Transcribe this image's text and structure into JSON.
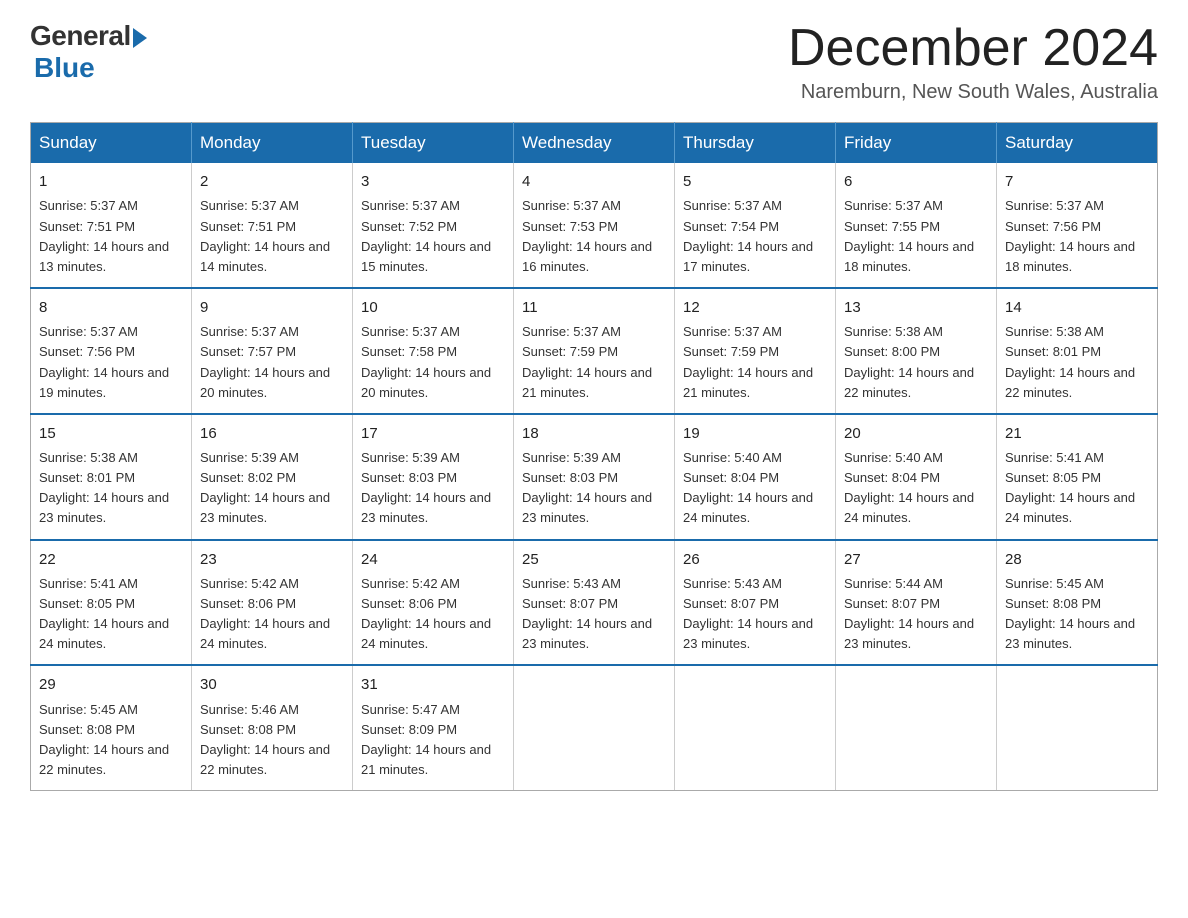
{
  "logo": {
    "general": "General",
    "blue": "Blue"
  },
  "title": "December 2024",
  "subtitle": "Naremburn, New South Wales, Australia",
  "weekdays": [
    "Sunday",
    "Monday",
    "Tuesday",
    "Wednesday",
    "Thursday",
    "Friday",
    "Saturday"
  ],
  "weeks": [
    [
      {
        "day": "1",
        "sunrise": "5:37 AM",
        "sunset": "7:51 PM",
        "daylight": "14 hours and 13 minutes."
      },
      {
        "day": "2",
        "sunrise": "5:37 AM",
        "sunset": "7:51 PM",
        "daylight": "14 hours and 14 minutes."
      },
      {
        "day": "3",
        "sunrise": "5:37 AM",
        "sunset": "7:52 PM",
        "daylight": "14 hours and 15 minutes."
      },
      {
        "day": "4",
        "sunrise": "5:37 AM",
        "sunset": "7:53 PM",
        "daylight": "14 hours and 16 minutes."
      },
      {
        "day": "5",
        "sunrise": "5:37 AM",
        "sunset": "7:54 PM",
        "daylight": "14 hours and 17 minutes."
      },
      {
        "day": "6",
        "sunrise": "5:37 AM",
        "sunset": "7:55 PM",
        "daylight": "14 hours and 18 minutes."
      },
      {
        "day": "7",
        "sunrise": "5:37 AM",
        "sunset": "7:56 PM",
        "daylight": "14 hours and 18 minutes."
      }
    ],
    [
      {
        "day": "8",
        "sunrise": "5:37 AM",
        "sunset": "7:56 PM",
        "daylight": "14 hours and 19 minutes."
      },
      {
        "day": "9",
        "sunrise": "5:37 AM",
        "sunset": "7:57 PM",
        "daylight": "14 hours and 20 minutes."
      },
      {
        "day": "10",
        "sunrise": "5:37 AM",
        "sunset": "7:58 PM",
        "daylight": "14 hours and 20 minutes."
      },
      {
        "day": "11",
        "sunrise": "5:37 AM",
        "sunset": "7:59 PM",
        "daylight": "14 hours and 21 minutes."
      },
      {
        "day": "12",
        "sunrise": "5:37 AM",
        "sunset": "7:59 PM",
        "daylight": "14 hours and 21 minutes."
      },
      {
        "day": "13",
        "sunrise": "5:38 AM",
        "sunset": "8:00 PM",
        "daylight": "14 hours and 22 minutes."
      },
      {
        "day": "14",
        "sunrise": "5:38 AM",
        "sunset": "8:01 PM",
        "daylight": "14 hours and 22 minutes."
      }
    ],
    [
      {
        "day": "15",
        "sunrise": "5:38 AM",
        "sunset": "8:01 PM",
        "daylight": "14 hours and 23 minutes."
      },
      {
        "day": "16",
        "sunrise": "5:39 AM",
        "sunset": "8:02 PM",
        "daylight": "14 hours and 23 minutes."
      },
      {
        "day": "17",
        "sunrise": "5:39 AM",
        "sunset": "8:03 PM",
        "daylight": "14 hours and 23 minutes."
      },
      {
        "day": "18",
        "sunrise": "5:39 AM",
        "sunset": "8:03 PM",
        "daylight": "14 hours and 23 minutes."
      },
      {
        "day": "19",
        "sunrise": "5:40 AM",
        "sunset": "8:04 PM",
        "daylight": "14 hours and 24 minutes."
      },
      {
        "day": "20",
        "sunrise": "5:40 AM",
        "sunset": "8:04 PM",
        "daylight": "14 hours and 24 minutes."
      },
      {
        "day": "21",
        "sunrise": "5:41 AM",
        "sunset": "8:05 PM",
        "daylight": "14 hours and 24 minutes."
      }
    ],
    [
      {
        "day": "22",
        "sunrise": "5:41 AM",
        "sunset": "8:05 PM",
        "daylight": "14 hours and 24 minutes."
      },
      {
        "day": "23",
        "sunrise": "5:42 AM",
        "sunset": "8:06 PM",
        "daylight": "14 hours and 24 minutes."
      },
      {
        "day": "24",
        "sunrise": "5:42 AM",
        "sunset": "8:06 PM",
        "daylight": "14 hours and 24 minutes."
      },
      {
        "day": "25",
        "sunrise": "5:43 AM",
        "sunset": "8:07 PM",
        "daylight": "14 hours and 23 minutes."
      },
      {
        "day": "26",
        "sunrise": "5:43 AM",
        "sunset": "8:07 PM",
        "daylight": "14 hours and 23 minutes."
      },
      {
        "day": "27",
        "sunrise": "5:44 AM",
        "sunset": "8:07 PM",
        "daylight": "14 hours and 23 minutes."
      },
      {
        "day": "28",
        "sunrise": "5:45 AM",
        "sunset": "8:08 PM",
        "daylight": "14 hours and 23 minutes."
      }
    ],
    [
      {
        "day": "29",
        "sunrise": "5:45 AM",
        "sunset": "8:08 PM",
        "daylight": "14 hours and 22 minutes."
      },
      {
        "day": "30",
        "sunrise": "5:46 AM",
        "sunset": "8:08 PM",
        "daylight": "14 hours and 22 minutes."
      },
      {
        "day": "31",
        "sunrise": "5:47 AM",
        "sunset": "8:09 PM",
        "daylight": "14 hours and 21 minutes."
      },
      null,
      null,
      null,
      null
    ]
  ]
}
